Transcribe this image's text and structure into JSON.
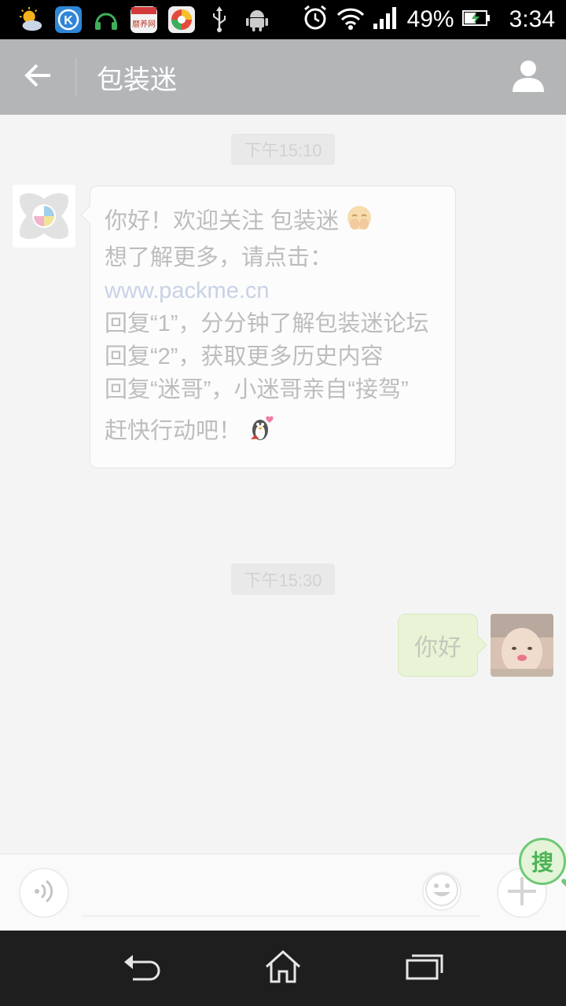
{
  "status_bar": {
    "battery": "49%",
    "time": "3:34",
    "calendar_app_text": "暦养网"
  },
  "header": {
    "title": "包装迷"
  },
  "messages": [
    {
      "timestamp": "下午15:10",
      "from": "official-account",
      "lines": {
        "line1": "你好！欢迎关注 包装迷",
        "line2_prefix": "想了解更多，请点击：",
        "link": "www.packme.cn",
        "line3": "回复“1”，分分钟了解包装迷论坛",
        "line4": "回复“2”，获取更多历史内容",
        "line5": "回复“迷哥”，小迷哥亲自“接驾”",
        "line6": "赶快行动吧！"
      }
    },
    {
      "timestamp": "下午15:30",
      "from": "me",
      "text": "你好"
    }
  ],
  "floating_search": {
    "label": "搜"
  },
  "colors": {
    "app_bar": "#b3b5b7",
    "chat_bg": "#f4f4f4",
    "outgoing_bubble": "#e9f4d6",
    "link": "#c8d2e6",
    "search_accent": "#6ec976"
  }
}
